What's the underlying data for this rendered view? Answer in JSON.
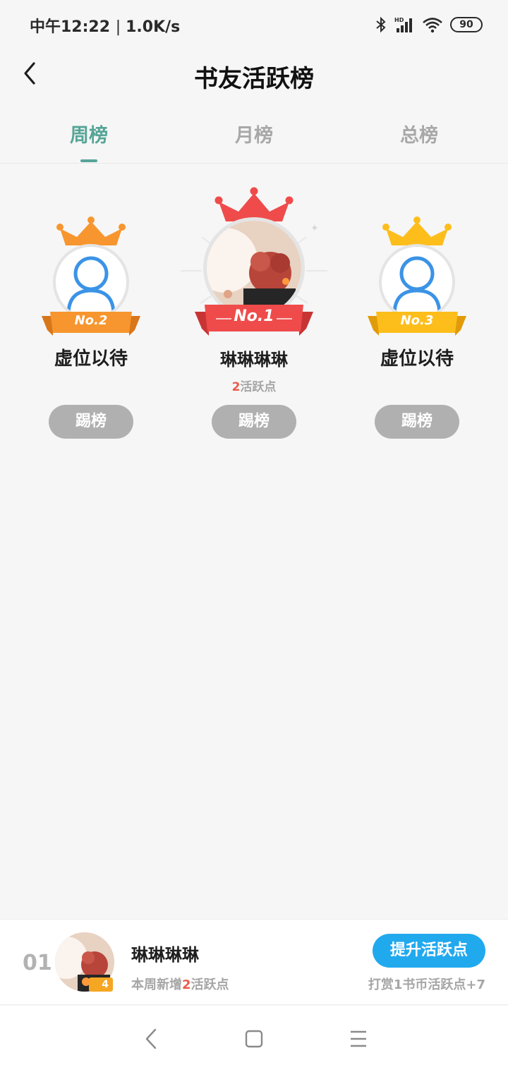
{
  "status_bar": {
    "time": "中午12:22",
    "speed": "1.0K/s",
    "battery": "90"
  },
  "header": {
    "title": "书友活跃榜"
  },
  "tabs": [
    {
      "label": "周榜",
      "active": true
    },
    {
      "label": "月榜",
      "active": false
    },
    {
      "label": "总榜",
      "active": false
    }
  ],
  "podium": {
    "first": {
      "rank_label": "No.1",
      "name": "琳琳琳琳",
      "points_value": "2",
      "points_unit": "活跃点",
      "button": "踢榜",
      "color": "#ef4b4b"
    },
    "second": {
      "rank_label": "No.2",
      "name": "虚位以待",
      "button": "踢榜",
      "color": "#f7962e"
    },
    "third": {
      "rank_label": "No.3",
      "name": "虚位以待",
      "button": "踢榜",
      "color": "#fdbe1c"
    }
  },
  "my_rank": {
    "rank": "01",
    "name": "琳琳琳琳",
    "level": "4",
    "sub_prefix": "本周新增",
    "sub_value": "2",
    "sub_suffix": "活跃点",
    "boost_button": "提升活跃点",
    "reward_hint": "打赏1书币活跃点+7"
  },
  "colors": {
    "accent": "#56a597",
    "boost": "#21a9ee",
    "highlight": "#ea5b4b"
  }
}
